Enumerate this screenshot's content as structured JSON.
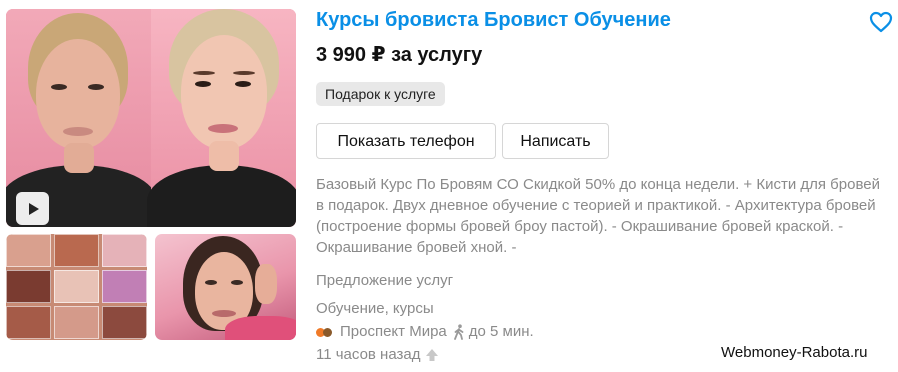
{
  "listing": {
    "title": "Курсы бровиста Бровист Обучение",
    "price": "3 990 ₽ за услугу",
    "badge": "Подарок к услуге",
    "buttons": {
      "show_phone": "Показать телефон",
      "write": "Написать"
    },
    "description": "Базовый Курс По Бровям СО Скидкой 50% до конца недели. + Кисти для бровей в подарок. Двух дневное обучение с теорией и практикой. - Архитектура бровей (построение формы бровей броу пастой). - Окрашивание бровей краской. - Окрашивание бровей хной. -",
    "offer_type": "Предложение услуг",
    "category": "Обучение, курсы",
    "metro": "Проспект Мира",
    "walk_time": "до 5 мин.",
    "posted": "11 часов назад"
  },
  "icons": {
    "favorite": "heart-outline-icon",
    "play": "play-icon",
    "walk": "walking-person-icon",
    "promoted": "arrow-up-icon",
    "metro": "metro-line-dots-icon"
  },
  "colors": {
    "title": "#0a8fe6",
    "muted_text": "#8a8a8a",
    "metro_dot_1": "#f07a28",
    "metro_dot_2": "#8a5a2b",
    "badge_bg": "#e8e8e8"
  },
  "watermark": "Webmoney-Rabota.ru"
}
